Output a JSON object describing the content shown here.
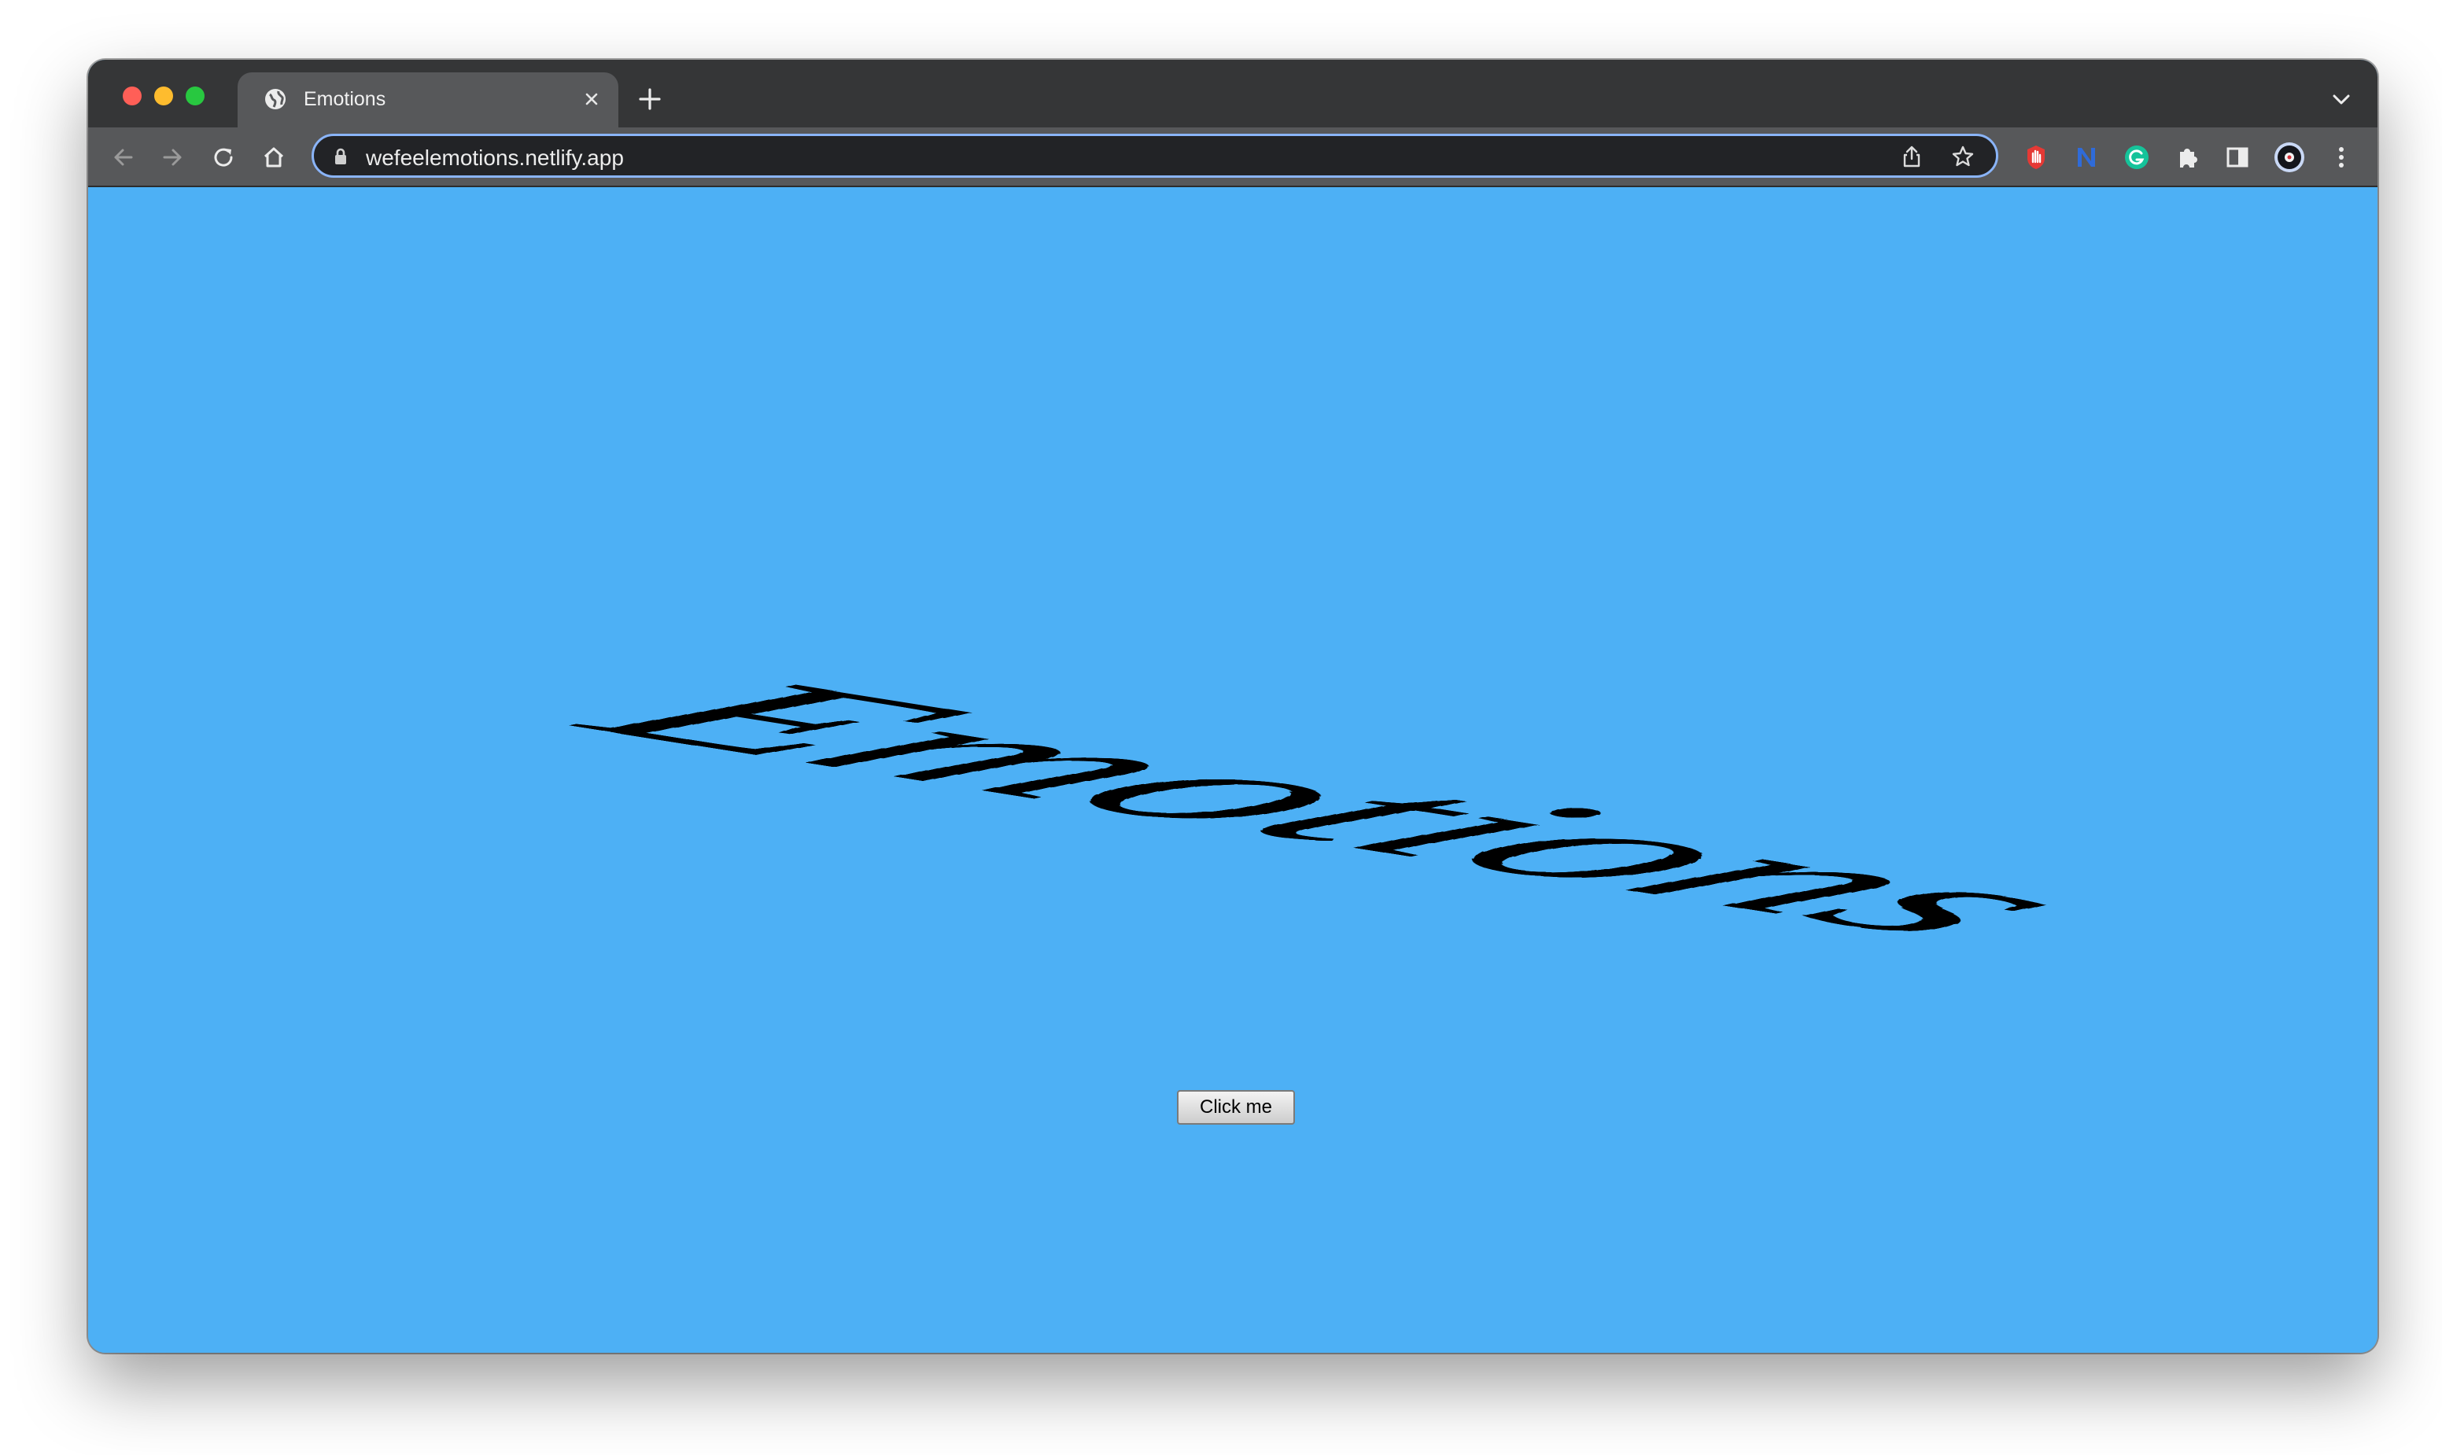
{
  "browser": {
    "tab": {
      "title": "Emotions",
      "icon": "globe-icon"
    },
    "address_bar": {
      "url": "wefeelemotions.netlify.app",
      "lock_icon": "lock-icon"
    },
    "toolbar_icons": [
      "back-arrow-icon",
      "forward-arrow-icon",
      "reload-icon",
      "home-icon",
      "share-icon",
      "star-icon",
      "hand-stop-icon",
      "n-extension-icon",
      "grammarly-icon",
      "puzzle-icon",
      "side-panel-icon",
      "profile-icon",
      "kebab-menu-icon"
    ],
    "traffic_light_colors": {
      "close": "#ff5f57",
      "minimize": "#febc2e",
      "maximize": "#28c840"
    }
  },
  "page": {
    "background_color": "#4db0f5",
    "heading": "Emotions",
    "button_label": "Click me"
  }
}
